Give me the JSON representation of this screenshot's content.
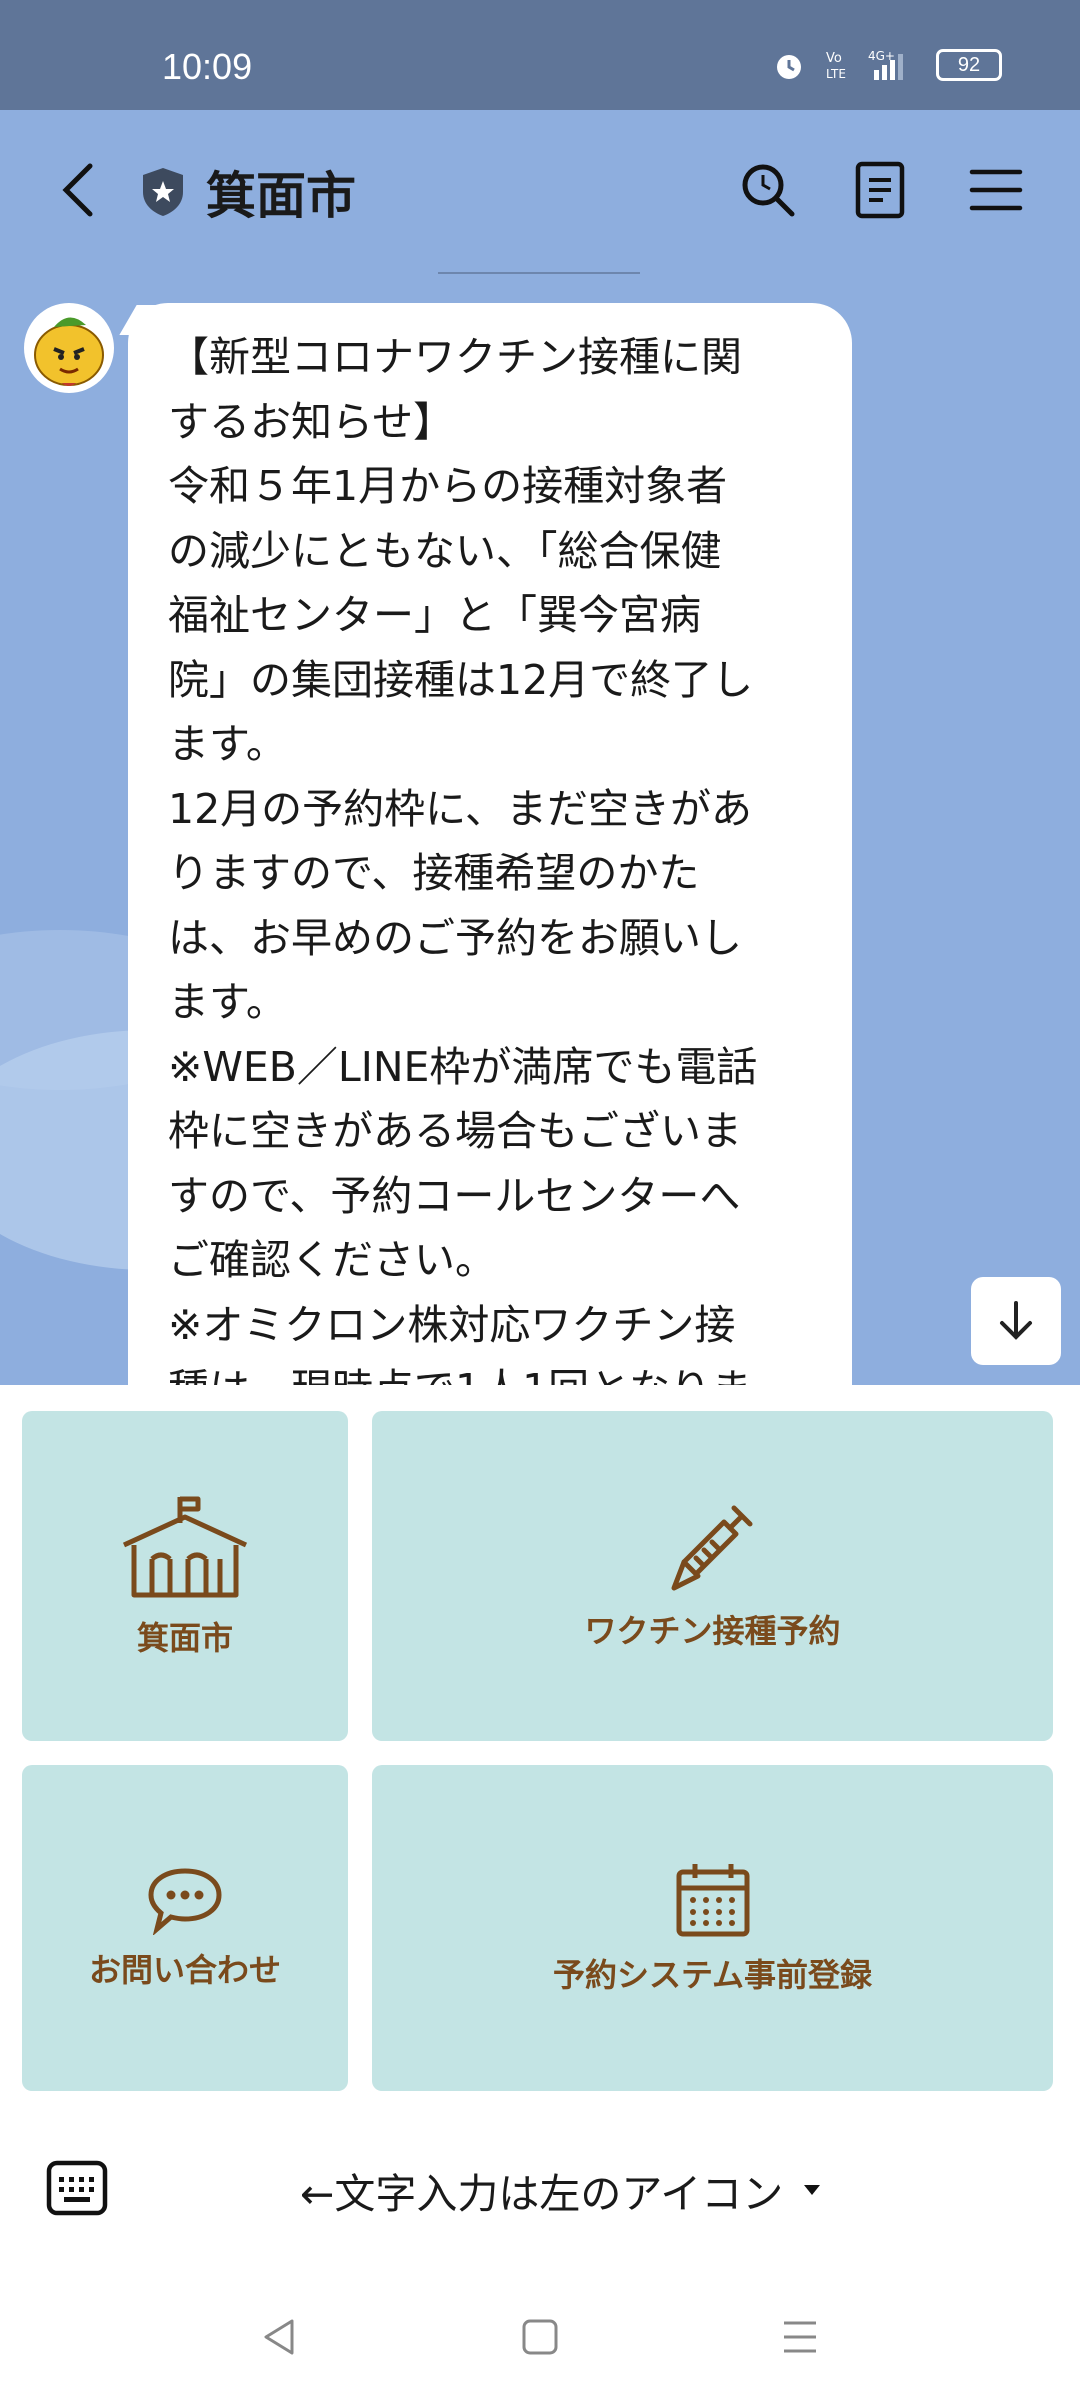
{
  "status_bar": {
    "time": "10:09",
    "battery": "92",
    "network": "4G+"
  },
  "header": {
    "title": "箕面市"
  },
  "message": {
    "text": "【新型コロナワクチン接種に関\nするお知らせ】\n令和５年1月からの接種対象者\nの減少にともない、「総合保健\n福祉センター」と「巽今宮病\n院」の集団接種は12月で終了し\nます。\n12月の予約枠に、まだ空きがあ\nりますので、接種希望のかた\nは、お早めのご予約をお願いし\nます。\n※WEB／LINE枠が満席でも電話\n枠に空きがある場合もございま\nすので、予約コールセンターへ\nご確認ください。\n※オミクロン株対応ワクチン接\n種は、現時点で1人1回となりま"
  },
  "rich_menu": {
    "items": [
      {
        "label": "箕面市",
        "icon": "school-icon"
      },
      {
        "label": "ワクチン接種予約",
        "icon": "syringe-icon"
      },
      {
        "label": "お問い合わせ",
        "icon": "chat-bubble-icon"
      },
      {
        "label": "予約システム事前登録",
        "icon": "calendar-icon"
      }
    ]
  },
  "input_bar": {
    "menu_label": "←文字入力は左のアイコン"
  },
  "colors": {
    "status_bar": "#5f7598",
    "chat_bg": "#8eaede",
    "tile_bg": "#c3e4e4",
    "tile_text": "#7a4a1c"
  }
}
